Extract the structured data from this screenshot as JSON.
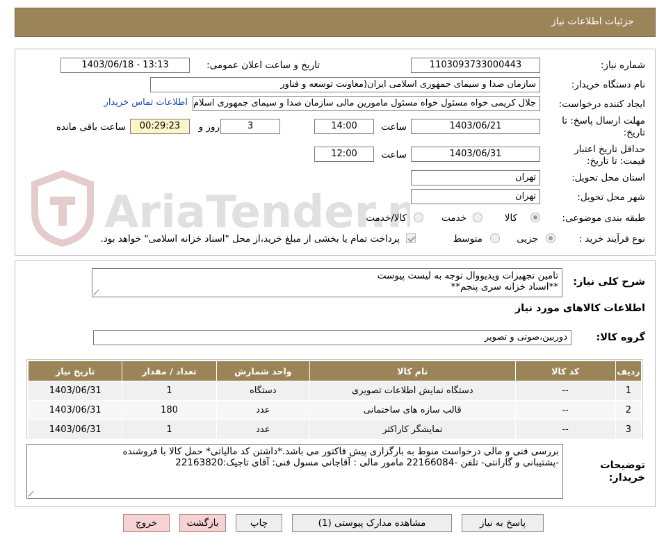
{
  "header": {
    "title": "جزئیات اطلاعات نیاز"
  },
  "watermark": {
    "text": "AriaTender.neT"
  },
  "form": {
    "need_number": {
      "label": "شماره نیاز:",
      "value": "1103093733000443"
    },
    "announce_date": {
      "label": "تاریخ و ساعت اعلان عمومی:",
      "value": "1403/06/18 - 13:13"
    },
    "buyer_org": {
      "label": "نام دستگاه خریدار:",
      "value": "سازمان صدا و سیمای جمهوری اسلامی ایران(معاونت توسعه و فناور"
    },
    "requester": {
      "label": "ایجاد کننده درخواست:",
      "value": "جلال کریمی خواه مسئول خواه مسئول مامورین مالی  سازمان صدا و سیمای جمهوری اسلام",
      "contact_link": "اطلاعات تماس خریدار"
    },
    "deadline": {
      "label_line1": "مهلت ارسال پاسخ: تا",
      "label_line2": "تاریخ:",
      "date": "1403/06/21",
      "time_label": "ساعت",
      "time": "14:00",
      "days": "3",
      "days_label": "روز و",
      "remaining": "00:29:23",
      "remaining_label": "ساعت باقی مانده"
    },
    "validity": {
      "label_line1": "حداقل تاریخ اعتبار",
      "label_line2": "قیمت: تا تاریخ:",
      "date": "1403/06/31",
      "time_label": "ساعت",
      "time": "12:00"
    },
    "province": {
      "label": "استان محل تحویل:",
      "value": "تهران"
    },
    "city": {
      "label": "شهر محل تحویل:",
      "value": "تهران"
    },
    "category": {
      "label": "طبقه بندی موضوعی:",
      "options": [
        "کالا",
        "خدمت",
        "کالا/خدمت"
      ],
      "selected": "کالا"
    },
    "purchase_type": {
      "label": "نوع فرآیند خرید :",
      "options": [
        "جزیی",
        "متوسط"
      ],
      "selected": "جزیی",
      "payment_note": "پرداخت تمام یا بخشی از مبلغ خرید،از محل \"اسناد خزانه اسلامی\" خواهد بود."
    }
  },
  "summary": {
    "label": "شرح کلی نیاز:",
    "line1": "تامین تجهیزات ویدیووال توجه به لیست پیوست",
    "line2": "**اسناد خزانه سری پنجم**"
  },
  "goods_section": {
    "title": "اطلاعات کالاهای مورد نیاز",
    "group_label": "گروه کالا:",
    "group_value": "دوربین،صوتی و تصویر"
  },
  "items_table": {
    "headers": [
      "ردیف",
      "کد کالا",
      "نام کالا",
      "واحد شمارش",
      "تعداد / مقدار",
      "تاریخ نیاز"
    ],
    "rows": [
      [
        "1",
        "--",
        "دستگاه نمایش اطلاعات تصویری",
        "دستگاه",
        "1",
        "1403/06/31"
      ],
      [
        "2",
        "--",
        "قالب سازه های ساختمانی",
        "عدد",
        "180",
        "1403/06/31"
      ],
      [
        "3",
        "--",
        "نمایشگر کاراکتر",
        "عدد",
        "1",
        "1403/06/31"
      ]
    ]
  },
  "buyer_notes": {
    "label_line1": "توضیحات",
    "label_line2": "خریدار:",
    "line1": "بررسی فنی و مالی درخواست منوط به بارگزاری پیش فاکتور می باشد.*داشتن کد مالیاتی*  حمل کالا با فروشنده",
    "line2": "-پشتیبانی و گارانتی- تلفن -22166084 مامور مالی : آقاجانی مسول فنی: آقای تاجیک:22163820"
  },
  "buttons": {
    "reply": "پاسخ به نیاز",
    "attachments": "مشاهده مدارک پیوستی (1)",
    "print": "چاپ",
    "back": "بازگشت",
    "exit": "خروج"
  }
}
